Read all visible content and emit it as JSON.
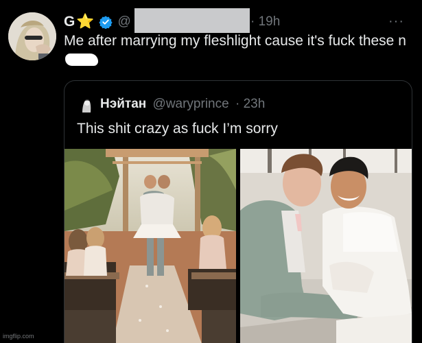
{
  "tweet": {
    "display_name": "G",
    "star_emoji": "⭐",
    "handle": "@",
    "time": "· 19h",
    "more_label": "···",
    "text": "Me after marrying my fleshlight cause it's fuck these n"
  },
  "quote": {
    "display_name": "Нэйтан",
    "handle": "@waryprince",
    "time": "· 23h",
    "text": "This shit crazy as fuck I’m sorry"
  },
  "watermark": "imgflip.com",
  "colors": {
    "background": "#000000",
    "text": "#e7e9ea",
    "muted": "#71767b",
    "verified": "#1d9bf0",
    "border": "#2f3336"
  }
}
